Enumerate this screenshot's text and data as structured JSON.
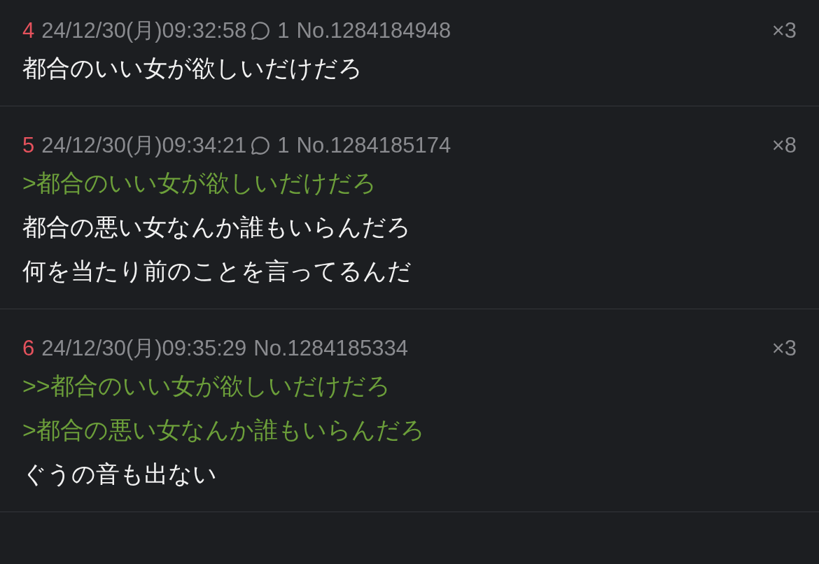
{
  "posts": [
    {
      "number": "4",
      "datetime": "24/12/30(月)09:32:58",
      "replies": "1",
      "post_no": "No.1284184948",
      "count": "×3",
      "lines": [
        {
          "kind": "text",
          "text": "都合のいい女が欲しいだけだろ"
        }
      ]
    },
    {
      "number": "5",
      "datetime": "24/12/30(月)09:34:21",
      "replies": "1",
      "post_no": "No.1284185174",
      "count": "×8",
      "lines": [
        {
          "kind": "quote",
          "text": ">都合のいい女が欲しいだけだろ"
        },
        {
          "kind": "text",
          "text": "都合の悪い女なんか誰もいらんだろ"
        },
        {
          "kind": "text",
          "text": "何を当たり前のことを言ってるんだ"
        }
      ]
    },
    {
      "number": "6",
      "datetime": "24/12/30(月)09:35:29",
      "post_no": "No.1284185334",
      "count": "×3",
      "lines": [
        {
          "kind": "quote",
          "text": ">>都合のいい女が欲しいだけだろ"
        },
        {
          "kind": "quote",
          "text": ">都合の悪い女なんか誰もいらんだろ"
        },
        {
          "kind": "text",
          "text": "ぐうの音も出ない"
        }
      ]
    }
  ]
}
